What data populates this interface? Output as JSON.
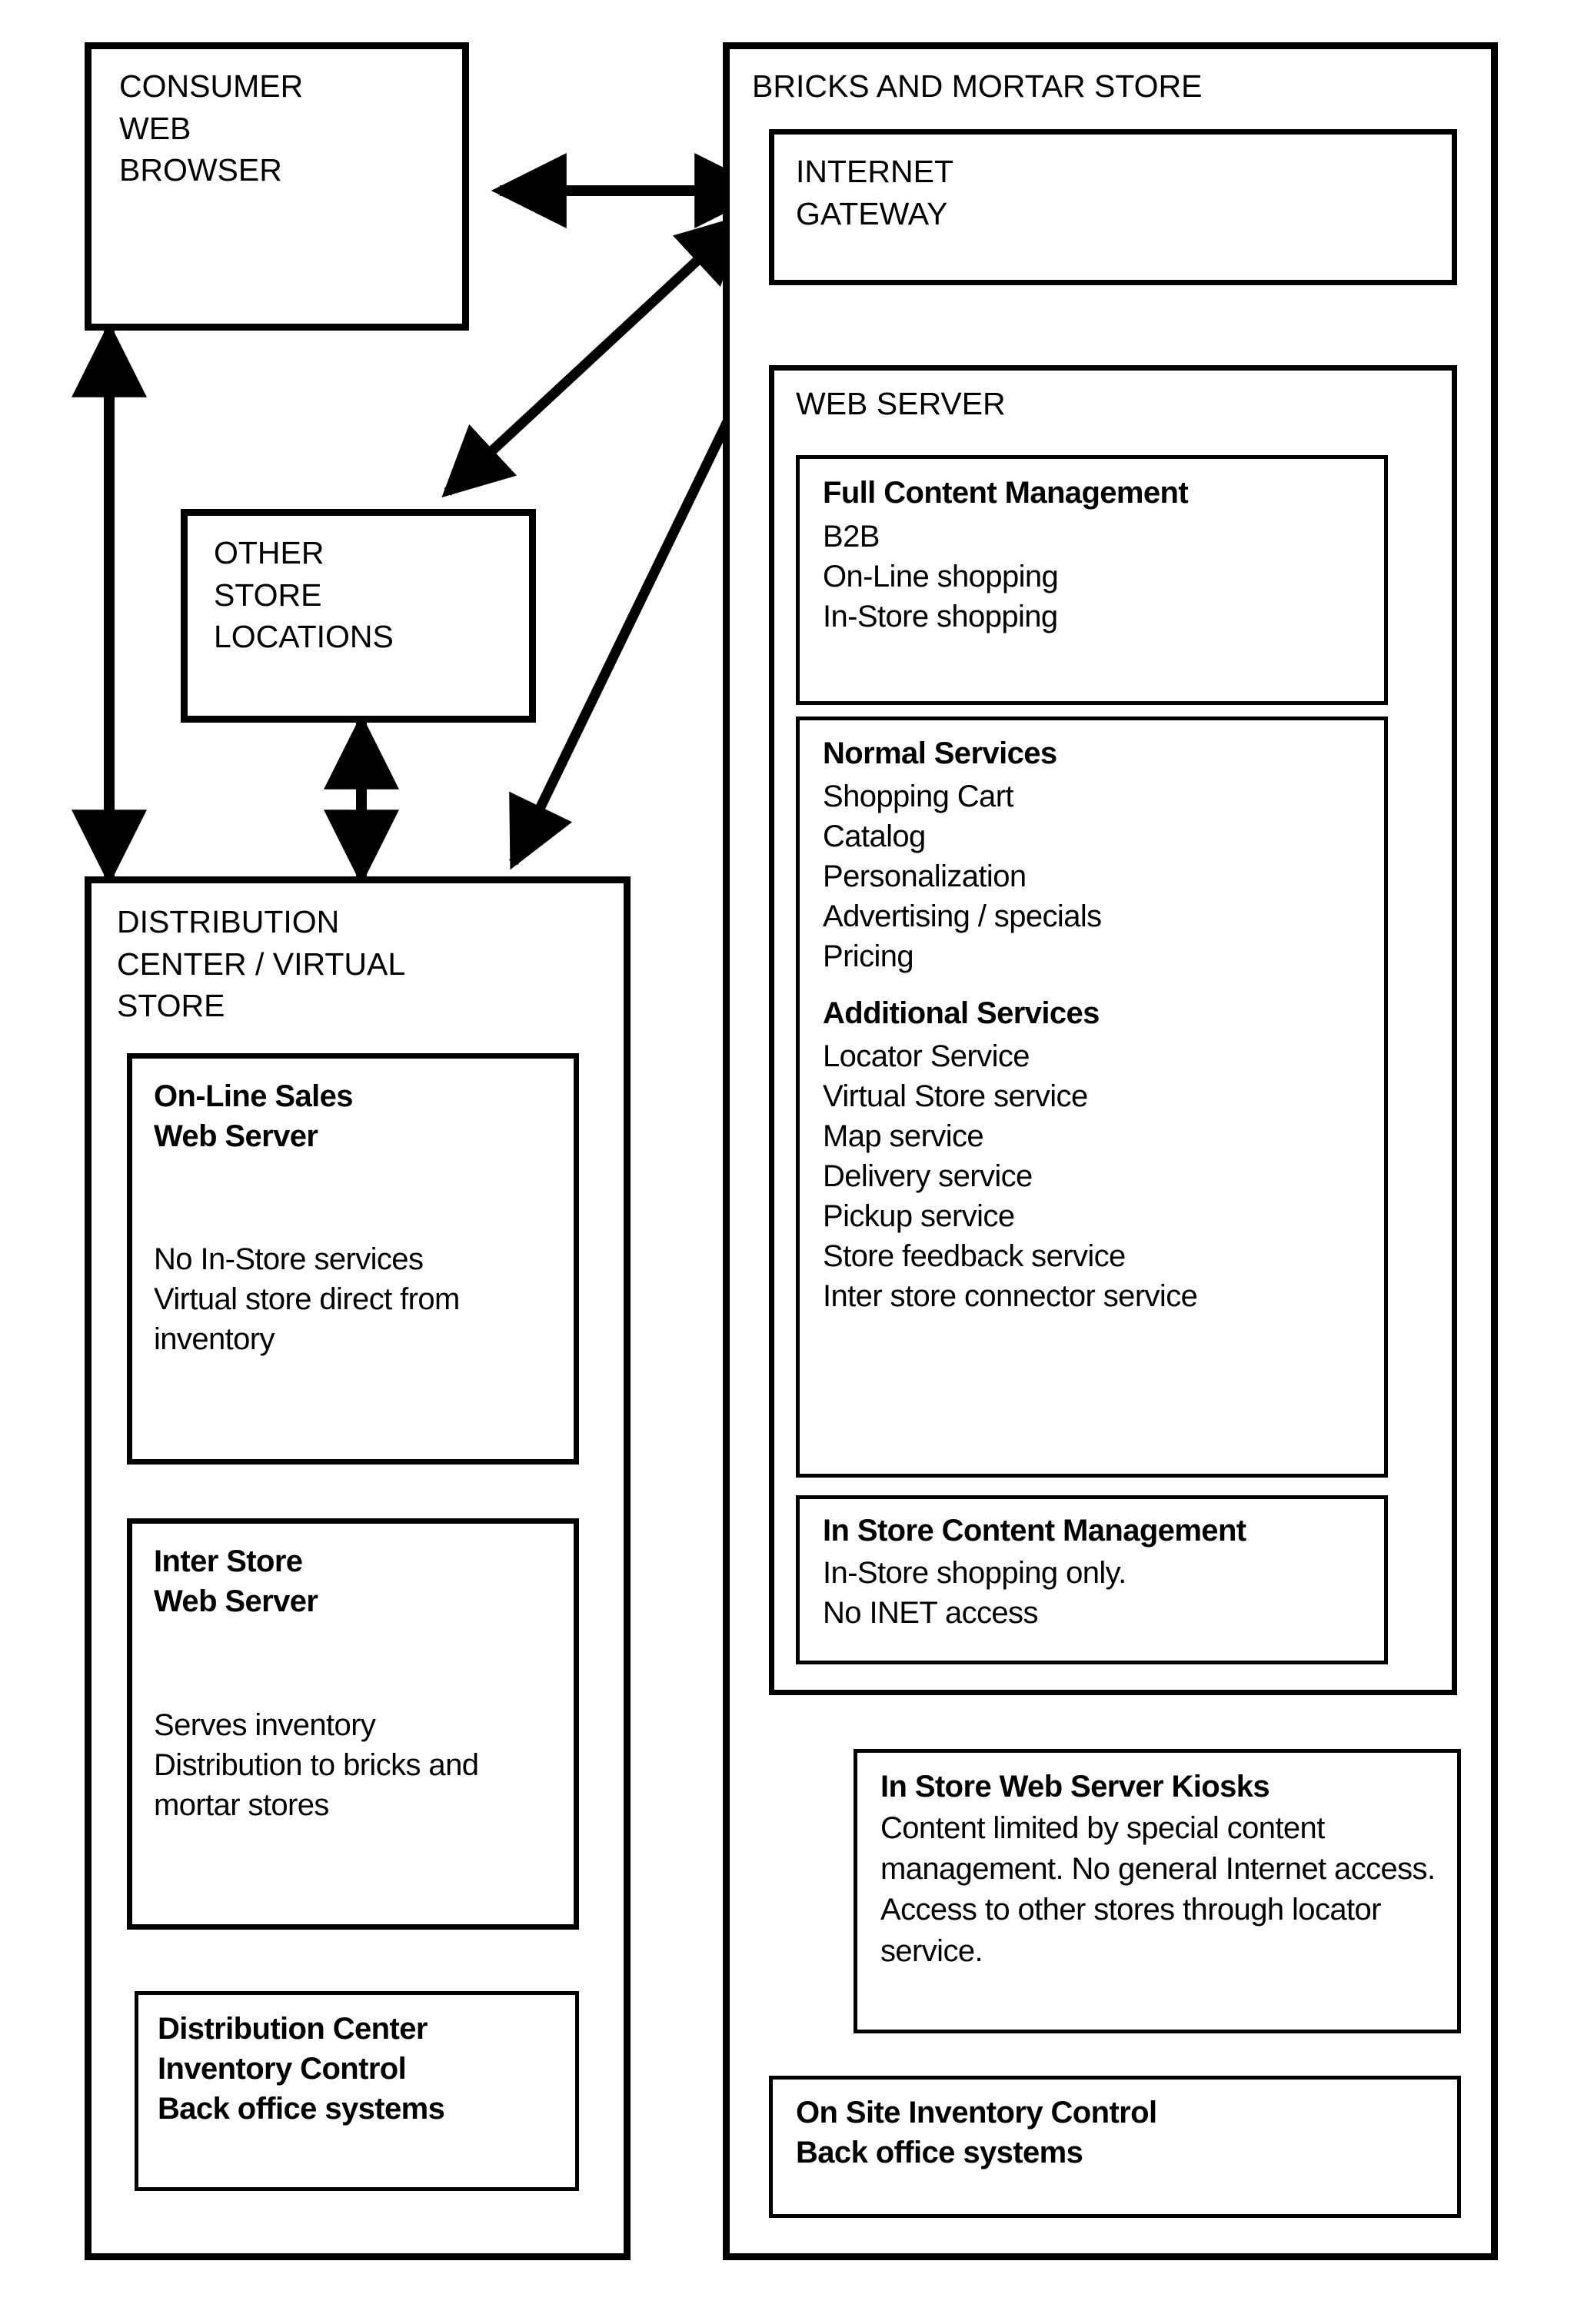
{
  "diagram": {
    "title": "Bricks and mortar store e-commerce architecture diagram",
    "left_column": {
      "consumer": {
        "line1": "CONSUMER",
        "line2": "WEB",
        "line3": "BROWSER"
      },
      "other_store_locations": {
        "line1": "OTHER",
        "line2": "STORE",
        "line3": "LOCATIONS"
      },
      "distribution_center": {
        "line1": "DISTRIBUTION",
        "line2": "CENTER / VIRTUAL",
        "line3": "STORE",
        "online_sales": {
          "heading_line1": "On-Line Sales",
          "heading_line2": "Web Server",
          "body_line1": "No In-Store services",
          "body_line2": "Virtual store direct from",
          "body_line3": "inventory"
        },
        "inter_store": {
          "heading_line1": "Inter Store",
          "heading_line2": "Web Server",
          "body_line1": "Serves inventory",
          "body_line2": "Distribution to bricks and",
          "body_line3": "mortar stores"
        },
        "inventory_control": {
          "line1": "Distribution Center",
          "line2": "Inventory Control",
          "line3": "Back office systems"
        }
      }
    },
    "right_column": {
      "bricks_and_mortar_store": {
        "title": "BRICKS AND MORTAR STORE",
        "internet_gateway": {
          "line1": "INTERNET",
          "line2": "GATEWAY"
        },
        "web_server": {
          "title": "WEB SERVER",
          "full_content_management": {
            "heading": "Full Content Management",
            "items": [
              "B2B",
              "On-Line shopping",
              "In-Store shopping"
            ]
          },
          "services": {
            "normal_heading": "Normal Services",
            "normal_items": [
              "Shopping Cart",
              "Catalog",
              "Personalization",
              "Advertising / specials",
              "Pricing"
            ],
            "additional_heading": "Additional Services",
            "additional_items": [
              "Locator Service",
              "Virtual Store service",
              "Map service",
              "Delivery service",
              "Pickup service",
              "Store feedback service",
              "Inter store connector service"
            ]
          },
          "in_store_content_management": {
            "heading": "In Store Content Management",
            "line1": "In-Store shopping only.",
            "line2": "No INET access"
          }
        },
        "kiosks": {
          "heading": "In Store Web Server Kiosks",
          "body": "Content limited by special content management. No general Internet access. Access to other stores through locator service."
        },
        "on_site_inventory": {
          "line1": "On Site Inventory Control",
          "line2": "Back office systems"
        }
      }
    },
    "connectors": [
      {
        "name": "consumer-browser-to-internet-gateway",
        "style": "double-arrow-horizontal"
      },
      {
        "name": "consumer-browser-to-distribution-center",
        "style": "double-arrow-vertical"
      },
      {
        "name": "other-store-locations-to-distribution-center",
        "style": "double-arrow-vertical"
      },
      {
        "name": "internet-gateway-to-other-store-locations",
        "style": "double-arrow-diagonal"
      },
      {
        "name": "distribution-center-to-internet-gateway",
        "style": "double-arrow-diagonal"
      },
      {
        "name": "internet-gateway-to-web-server",
        "style": "double-arrow-vertical"
      },
      {
        "name": "web-server-to-full-content-management",
        "style": "arrow-down"
      },
      {
        "name": "in-store-content-management-to-kiosks",
        "style": "double-arrow-vertical"
      },
      {
        "name": "kiosks-bus-to-on-site-inventory",
        "style": "bus-line-with-junctions"
      }
    ],
    "colors": {
      "stroke": "#000000",
      "background": "#ffffff"
    }
  }
}
